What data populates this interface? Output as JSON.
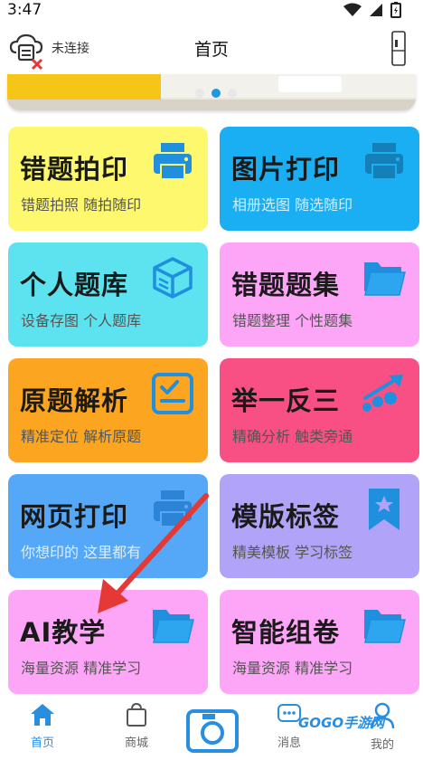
{
  "status_bar": {
    "time": "3:47"
  },
  "header": {
    "connection_text": "未连接",
    "title": "首页"
  },
  "colors": {
    "accent": "#2a8ee0",
    "card_yellow": "#fdf86e",
    "card_blue": "#1aaef2",
    "card_cyan": "#5ce3ef",
    "card_pink": "#fda5f6",
    "card_orange": "#fba520",
    "card_rose": "#f84f84",
    "card_sky": "#55a8f7",
    "card_lavender": "#b1a4f8",
    "icon_blue": "#1f8fde",
    "arrow_red": "#e53935"
  },
  "cards": [
    {
      "title": "错题拍印",
      "subtitle": "错题拍照 随拍随印",
      "icon": "printer-icon"
    },
    {
      "title": "图片打印",
      "subtitle": "相册选图 随选随印",
      "icon": "printer-icon"
    },
    {
      "title": "个人题库",
      "subtitle": "设备存图 个人题库",
      "icon": "box-icon"
    },
    {
      "title": "错题题集",
      "subtitle": "错题整理 个性题集",
      "icon": "folder-icon"
    },
    {
      "title": "原题解析",
      "subtitle": "精准定位 解析原题",
      "icon": "checklist-icon"
    },
    {
      "title": "举一反三",
      "subtitle": "精确分析 触类旁通",
      "icon": "growth-chart-icon"
    },
    {
      "title": "网页打印",
      "subtitle": "你想印的 这里都有",
      "icon": "printer-icon"
    },
    {
      "title": "模版标签",
      "subtitle": "精美模板 学习标签",
      "icon": "bookmark-star-icon"
    },
    {
      "title": "AI教学",
      "subtitle": "海量资源 精准学习",
      "icon": "folder-icon"
    },
    {
      "title": "智能组卷",
      "subtitle": "海量资源 精准学习",
      "icon": "folder-icon"
    }
  ],
  "bottom_nav": {
    "home": "首页",
    "mall": "商城",
    "messages": "消息",
    "mine": "我的"
  },
  "watermark": "GOGO手游网"
}
